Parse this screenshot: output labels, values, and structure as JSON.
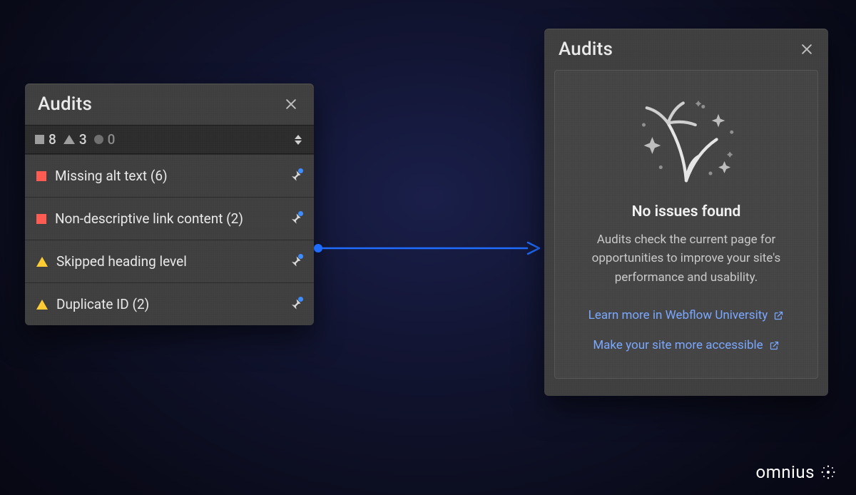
{
  "left_panel": {
    "title": "Audits",
    "counts": {
      "errors": "8",
      "warnings": "3",
      "info": "0"
    },
    "issues": [
      {
        "severity": "error",
        "label": "Missing alt text (6)"
      },
      {
        "severity": "error",
        "label": "Non-descriptive link content (2)"
      },
      {
        "severity": "warn",
        "label": "Skipped heading level"
      },
      {
        "severity": "warn",
        "label": "Duplicate ID (2)"
      }
    ]
  },
  "right_panel": {
    "title": "Audits",
    "empty_title": "No issues found",
    "empty_desc": "Audits check the current page for opportunities to improve your site's performance and usability.",
    "link1": "Learn more in Webflow University",
    "link2": "Make your site more accessible"
  },
  "brand": "omnius",
  "icons": {
    "close": "close-icon",
    "expand": "expand-collapse-icon",
    "pin": "pin-icon",
    "external": "external-link-icon",
    "firework": "firework-illustration",
    "brand": "brand-glyph"
  }
}
